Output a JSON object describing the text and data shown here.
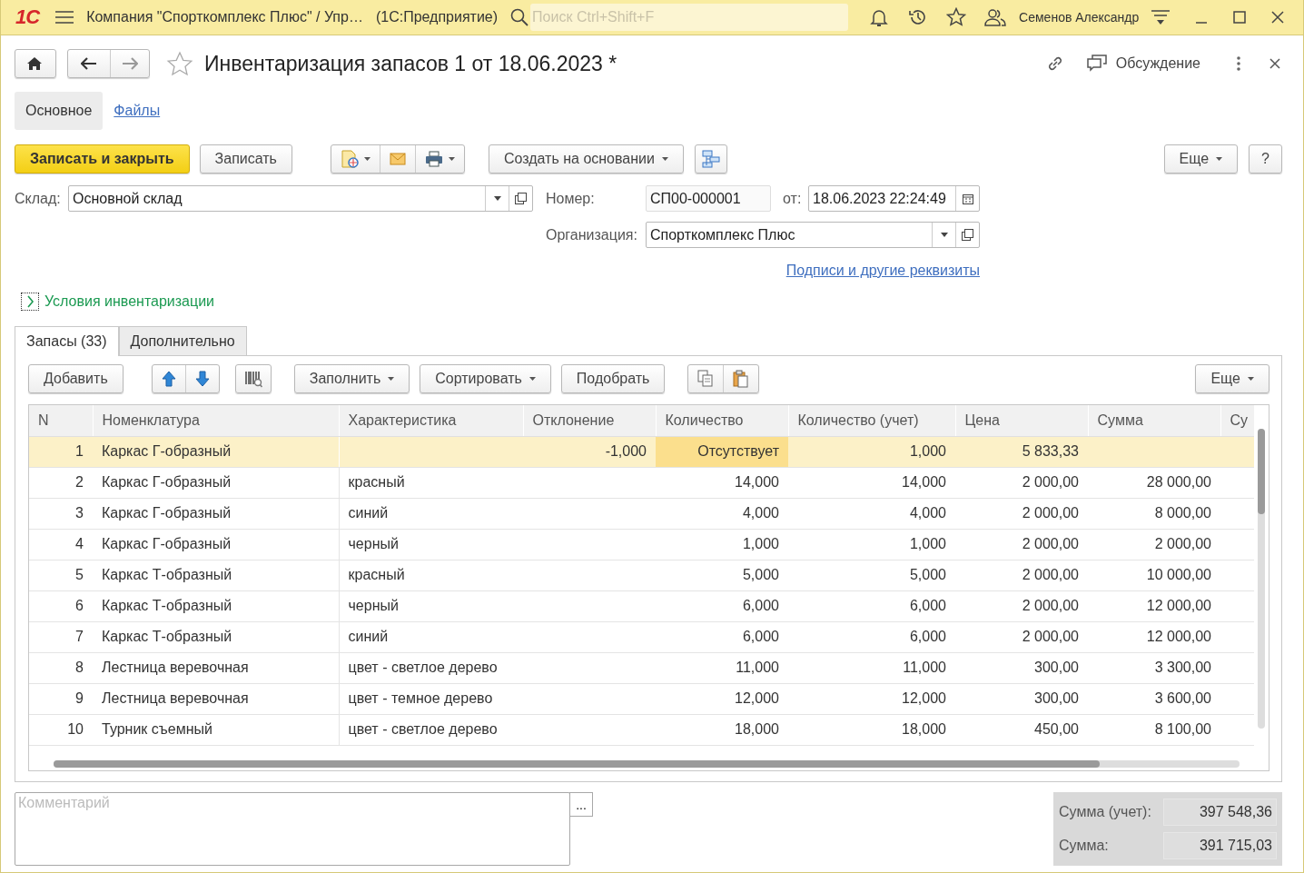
{
  "titlebar": {
    "logo": "1С",
    "app_title": "Компания \"Спорткомплекс Плюс\" / Упр…",
    "platform": "(1С:Предприятие)",
    "search": {
      "placeholder": "Поиск Ctrl+Shift+F"
    },
    "user": "Семенов Александр"
  },
  "document": {
    "title": "Инвентаризация запасов 1 от 18.06.2023 *",
    "favorite": false,
    "discussion": "Обсуждение"
  },
  "sections": [
    {
      "label": "Основное",
      "selected": true
    },
    {
      "label": "Файлы",
      "selected": false
    }
  ],
  "toolbar": {
    "primary": "Записать и закрыть",
    "save": "Записать",
    "create_based": "Создать на основании",
    "more": "Еще",
    "help": "?"
  },
  "fields": {
    "warehouse": {
      "label": "Склад:",
      "value": "Основной склад"
    },
    "number": {
      "label": "Номер:",
      "value": "СП00-000001"
    },
    "date": {
      "label": "от:",
      "value": "18.06.2023 22:24:49"
    },
    "organization": {
      "label": "Организация:",
      "value": "Спорткомплекс Плюс"
    },
    "link": "Подписи и другие реквизиты"
  },
  "conditions": {
    "label": "Условия инвентаризации",
    "expanded": false
  },
  "tabs": [
    {
      "label": "Запасы (33)",
      "selected": true
    },
    {
      "label": "Дополнительно",
      "selected": false
    }
  ],
  "table_toolbar": {
    "add": "Добавить",
    "fill": "Заполнить",
    "sort": "Сортировать",
    "pick": "Подобрать",
    "more": "Еще"
  },
  "table": {
    "columns": [
      "N",
      "Номенклатура",
      "Характеристика",
      "Отклонение",
      "Количество",
      "Количество (учет)",
      "Цена",
      "Сумма",
      "Су"
    ],
    "rows": [
      {
        "n": "1",
        "item": "Каркас Г-образный",
        "deviation": "-1,000",
        "quantity": "Отсутствует",
        "quantity_book": "1,000",
        "price": "5 833,33",
        "selected": true,
        "quantity_focused": true
      },
      {
        "n": "2",
        "item": "Каркас Г-образный",
        "feature": "красный",
        "quantity": "14,000",
        "quantity_book": "14,000",
        "price": "2 000,00",
        "amount": "28 000,00",
        "selected": false
      },
      {
        "n": "3",
        "item": "Каркас Г-образный",
        "feature": "синий",
        "quantity": "4,000",
        "quantity_book": "4,000",
        "price": "2 000,00",
        "amount": "8 000,00",
        "selected": false
      },
      {
        "n": "4",
        "item": "Каркас Г-образный",
        "feature": "черный",
        "quantity": "1,000",
        "quantity_book": "1,000",
        "price": "2 000,00",
        "amount": "2 000,00",
        "selected": false
      },
      {
        "n": "5",
        "item": "Каркас Т-образный",
        "feature": "красный",
        "quantity": "5,000",
        "quantity_book": "5,000",
        "price": "2 000,00",
        "amount": "10 000,00",
        "selected": false
      },
      {
        "n": "6",
        "item": "Каркас Т-образный",
        "feature": "черный",
        "quantity": "6,000",
        "quantity_book": "6,000",
        "price": "2 000,00",
        "amount": "12 000,00",
        "selected": false
      },
      {
        "n": "7",
        "item": "Каркас Т-образный",
        "feature": "синий",
        "quantity": "6,000",
        "quantity_book": "6,000",
        "price": "2 000,00",
        "amount": "12 000,00",
        "selected": false
      },
      {
        "n": "8",
        "item": "Лестница веревочная",
        "feature": "цвет - светлое дерево",
        "quantity": "11,000",
        "quantity_book": "11,000",
        "price": "300,00",
        "amount": "3 300,00",
        "selected": false
      },
      {
        "n": "9",
        "item": "Лестница веревочная",
        "feature": "цвет - темное дерево",
        "quantity": "12,000",
        "quantity_book": "12,000",
        "price": "300,00",
        "amount": "3 600,00",
        "selected": false
      },
      {
        "n": "10",
        "item": "Турник съемный",
        "feature": "цвет - светлое дерево",
        "quantity": "18,000",
        "quantity_book": "18,000",
        "price": "450,00",
        "amount": "8 100,00",
        "selected": false
      }
    ]
  },
  "comment": {
    "placeholder": "Комментарий",
    "button": "..."
  },
  "totals": [
    {
      "label": "Сумма (учет):",
      "value": "397 548,36"
    },
    {
      "label": "Сумма:",
      "value": "391 715,03"
    }
  ]
}
